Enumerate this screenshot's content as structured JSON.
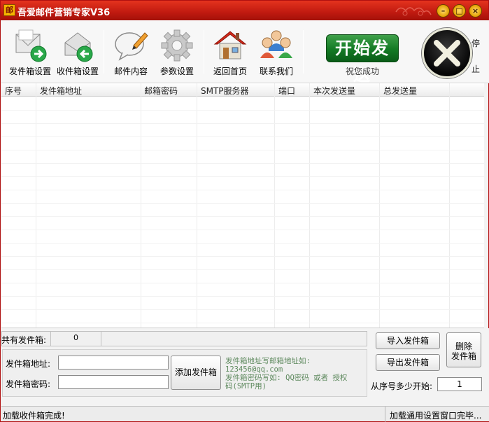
{
  "window": {
    "title": "吾爱邮件营销专家V36",
    "app_icon_glyph": "邮"
  },
  "titlebar_buttons": {
    "minimize": "–",
    "maximize": "□",
    "close": "×"
  },
  "toolbar": {
    "items": [
      {
        "label": "发件箱设置",
        "icon": "envelope-send-icon"
      },
      {
        "label": "收件箱设置",
        "icon": "envelope-receive-icon"
      },
      {
        "label": "邮件内容",
        "icon": "speech-bubble-pen-icon"
      },
      {
        "label": "参数设置",
        "icon": "gear-icon"
      },
      {
        "label": "返回首页",
        "icon": "home-icon"
      },
      {
        "label": "联系我们",
        "icon": "people-icon"
      }
    ],
    "start_button": "开始发送",
    "start_caption": "祝您成功",
    "stop_label_1": "停",
    "stop_label_2": "止"
  },
  "table": {
    "columns": [
      "序号",
      "发件箱地址",
      "邮箱密码",
      "SMTP服务器",
      "端口",
      "本次发送量",
      "总发送量"
    ],
    "rows": []
  },
  "stats": {
    "total_label": "共有发件箱:",
    "total_value": "0"
  },
  "form": {
    "address_label": "发件箱地址:",
    "address_value": "",
    "password_label": "发件箱密码:",
    "password_value": "",
    "add_button": "添加发件箱",
    "hint_line1": "发件箱地址写邮箱地址如:",
    "hint_line2": "123456@qq.com",
    "hint_line3": "发件箱密码写如: QQ密码 或者 授权",
    "hint_line4": "码(SMTP用)"
  },
  "actions": {
    "import_button": "导入发件箱",
    "export_button": "导出发件箱",
    "delete_button_1": "删除",
    "delete_button_2": "发件箱",
    "start_index_label": "从序号多少开始:",
    "start_index_value": "1"
  },
  "status": {
    "left": "加载收件箱完成!",
    "right": "加载通用设置窗口完毕..."
  },
  "colors": {
    "title_red": "#c01a10",
    "start_green": "#137a24",
    "hint_green": "#5f8a5f"
  }
}
